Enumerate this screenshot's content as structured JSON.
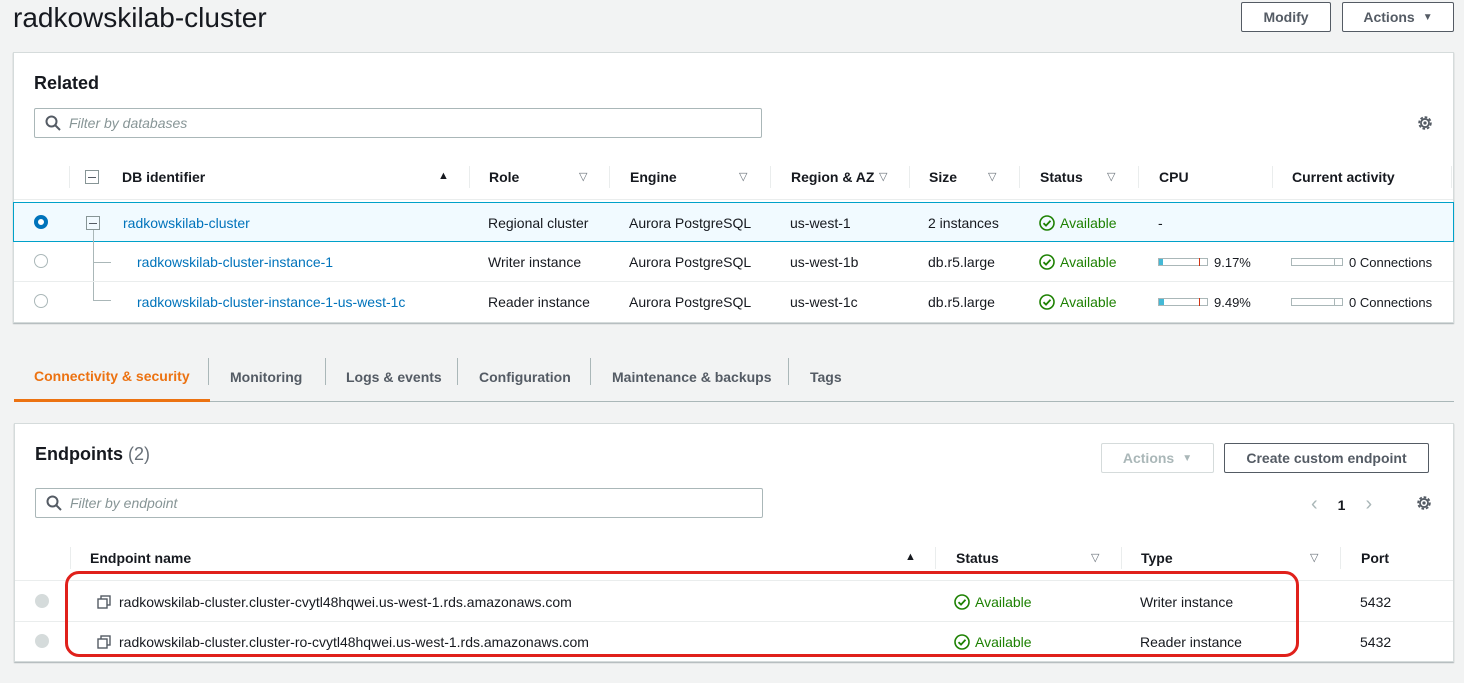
{
  "header": {
    "title": "radkowskilab-cluster",
    "modify_label": "Modify",
    "actions_label": "Actions"
  },
  "related": {
    "title": "Related",
    "filter_placeholder": "Filter by databases",
    "columns": [
      "DB identifier",
      "Role",
      "Engine",
      "Region & AZ",
      "Size",
      "Status",
      "CPU",
      "Current activity"
    ],
    "rows": [
      {
        "id": "radkowskilab-cluster",
        "role": "Regional cluster",
        "engine": "Aurora PostgreSQL",
        "region": "us-west-1",
        "size": "2 instances",
        "status": "Available",
        "cpu": "-",
        "activity": ""
      },
      {
        "id": "radkowskilab-cluster-instance-1",
        "role": "Writer instance",
        "engine": "Aurora PostgreSQL",
        "region": "us-west-1b",
        "size": "db.r5.large",
        "status": "Available",
        "cpu": "9.17%",
        "cpu_value": 9.17,
        "activity": "0 Connections"
      },
      {
        "id": "radkowskilab-cluster-instance-1-us-west-1c",
        "role": "Reader instance",
        "engine": "Aurora PostgreSQL",
        "region": "us-west-1c",
        "size": "db.r5.large",
        "status": "Available",
        "cpu": "9.49%",
        "cpu_value": 9.49,
        "activity": "0 Connections"
      }
    ]
  },
  "tabs": [
    {
      "label": "Connectivity & security",
      "active": true
    },
    {
      "label": "Monitoring"
    },
    {
      "label": "Logs & events"
    },
    {
      "label": "Configuration"
    },
    {
      "label": "Maintenance & backups"
    },
    {
      "label": "Tags"
    }
  ],
  "endpoints": {
    "title": "Endpoints",
    "count": "(2)",
    "actions_label": "Actions",
    "create_label": "Create custom endpoint",
    "filter_placeholder": "Filter by endpoint",
    "page": "1",
    "columns": [
      "Endpoint name",
      "Status",
      "Type",
      "Port"
    ],
    "rows": [
      {
        "name": "radkowskilab-cluster.cluster-cvytl48hqwei.us-west-1.rds.amazonaws.com",
        "status": "Available",
        "type": "Writer instance",
        "port": "5432"
      },
      {
        "name": "radkowskilab-cluster.cluster-ro-cvytl48hqwei.us-west-1.rds.amazonaws.com",
        "status": "Available",
        "type": "Reader instance",
        "port": "5432"
      }
    ]
  },
  "colors": {
    "accent_tab": "#ec7211",
    "link": "#0073bb",
    "available": "#1d8102",
    "highlight": "#e0201b"
  }
}
